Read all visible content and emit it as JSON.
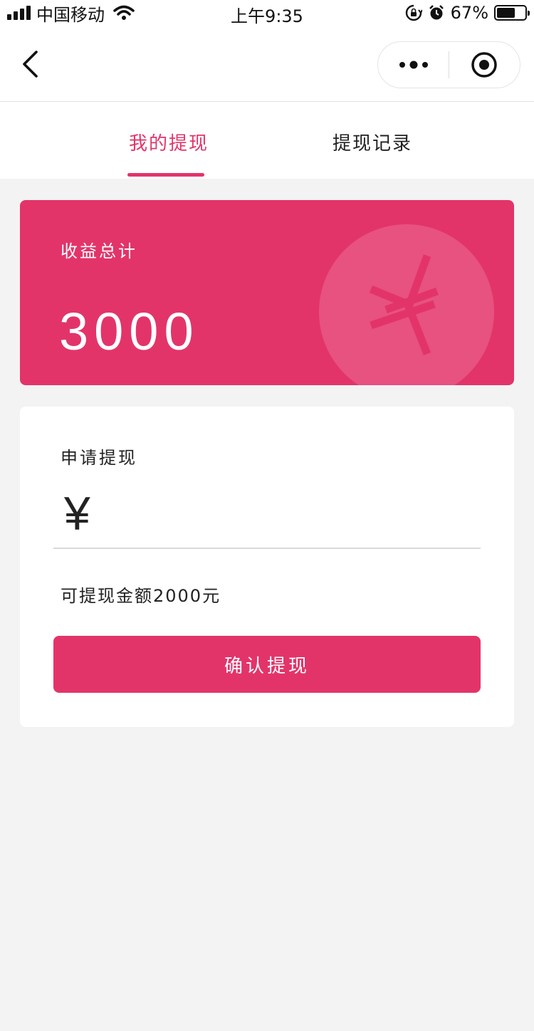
{
  "status_bar": {
    "carrier": "中国移动",
    "time": "上午9:35",
    "battery": "67%",
    "battery_level": 0.67,
    "icons": [
      "signal-icon",
      "wifi-icon",
      "orientation-lock-icon",
      "alarm-icon",
      "battery-icon"
    ]
  },
  "nav": {
    "back_icon": "chevron-left-icon",
    "more_icon": "more-dots-icon",
    "close_icon": "target-circle-icon"
  },
  "tabs": {
    "items": [
      {
        "label": "我的提现",
        "active": true
      },
      {
        "label": "提现记录",
        "active": false
      }
    ]
  },
  "income_card": {
    "label": "收益总计",
    "value": "3000",
    "icon": "yen-coin-icon"
  },
  "withdraw": {
    "title": "申请提现",
    "currency_symbol": "¥",
    "amount_value": "",
    "available_text": "可提现金额2000元",
    "confirm_label": "确认提现"
  },
  "colors": {
    "accent": "#e3346a",
    "background": "#f3f3f3",
    "card": "#ffffff"
  }
}
